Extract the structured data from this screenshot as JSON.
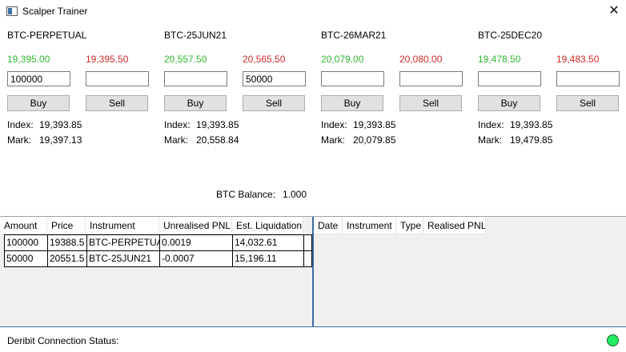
{
  "window": {
    "title": "Scalper Trainer",
    "close_glyph": "✕"
  },
  "instruments": [
    {
      "name": "BTC-PERPETUAL",
      "bid": "19,395.00",
      "ask": "19,395.50",
      "buy_qty": "100000",
      "sell_qty": "",
      "buy_label": "Buy",
      "sell_label": "Sell",
      "index_label": "Index:",
      "index": "19,393.85",
      "mark_label": "Mark:",
      "mark": "19,397.13"
    },
    {
      "name": "BTC-25JUN21",
      "bid": "20,557.50",
      "ask": "20,565.50",
      "buy_qty": "",
      "sell_qty": "50000",
      "buy_label": "Buy",
      "sell_label": "Sell",
      "index_label": "Index:",
      "index": "19,393.85",
      "mark_label": "Mark:",
      "mark": "20,558.84"
    },
    {
      "name": "BTC-26MAR21",
      "bid": "20,079.00",
      "ask": "20,080.00",
      "buy_qty": "",
      "sell_qty": "",
      "buy_label": "Buy",
      "sell_label": "Sell",
      "index_label": "Index:",
      "index": "19,393.85",
      "mark_label": "Mark:",
      "mark": "20,079.85"
    },
    {
      "name": "BTC-25DEC20",
      "bid": "19,478.50",
      "ask": "19,483.50",
      "buy_qty": "",
      "sell_qty": "",
      "buy_label": "Buy",
      "sell_label": "Sell",
      "index_label": "Index:",
      "index": "19,393.85",
      "mark_label": "Mark:",
      "mark": "19,479.85"
    }
  ],
  "balance": {
    "label": "BTC Balance:",
    "value": "1.000"
  },
  "positions": {
    "headers": [
      "Amount",
      "Price",
      "Instrument",
      "Unrealised PNL",
      "Est. Liquidation"
    ],
    "rows": [
      [
        "100000",
        "19388.5",
        "BTC-PERPETUAL",
        "0.0019",
        "14,032.61"
      ],
      [
        "50000",
        "20551.5",
        "BTC-25JUN21",
        "-0.0007",
        "15,196.11"
      ]
    ]
  },
  "history": {
    "headers": [
      "Date",
      "Instrument",
      "Type",
      "Realised PNL"
    ]
  },
  "status": {
    "label": "Deribit Connection Status:",
    "connected_color": "#22ee66"
  },
  "colors": {
    "bid": "#2eb82e",
    "ask": "#d42a2a",
    "accent": "#3c6ea0"
  }
}
